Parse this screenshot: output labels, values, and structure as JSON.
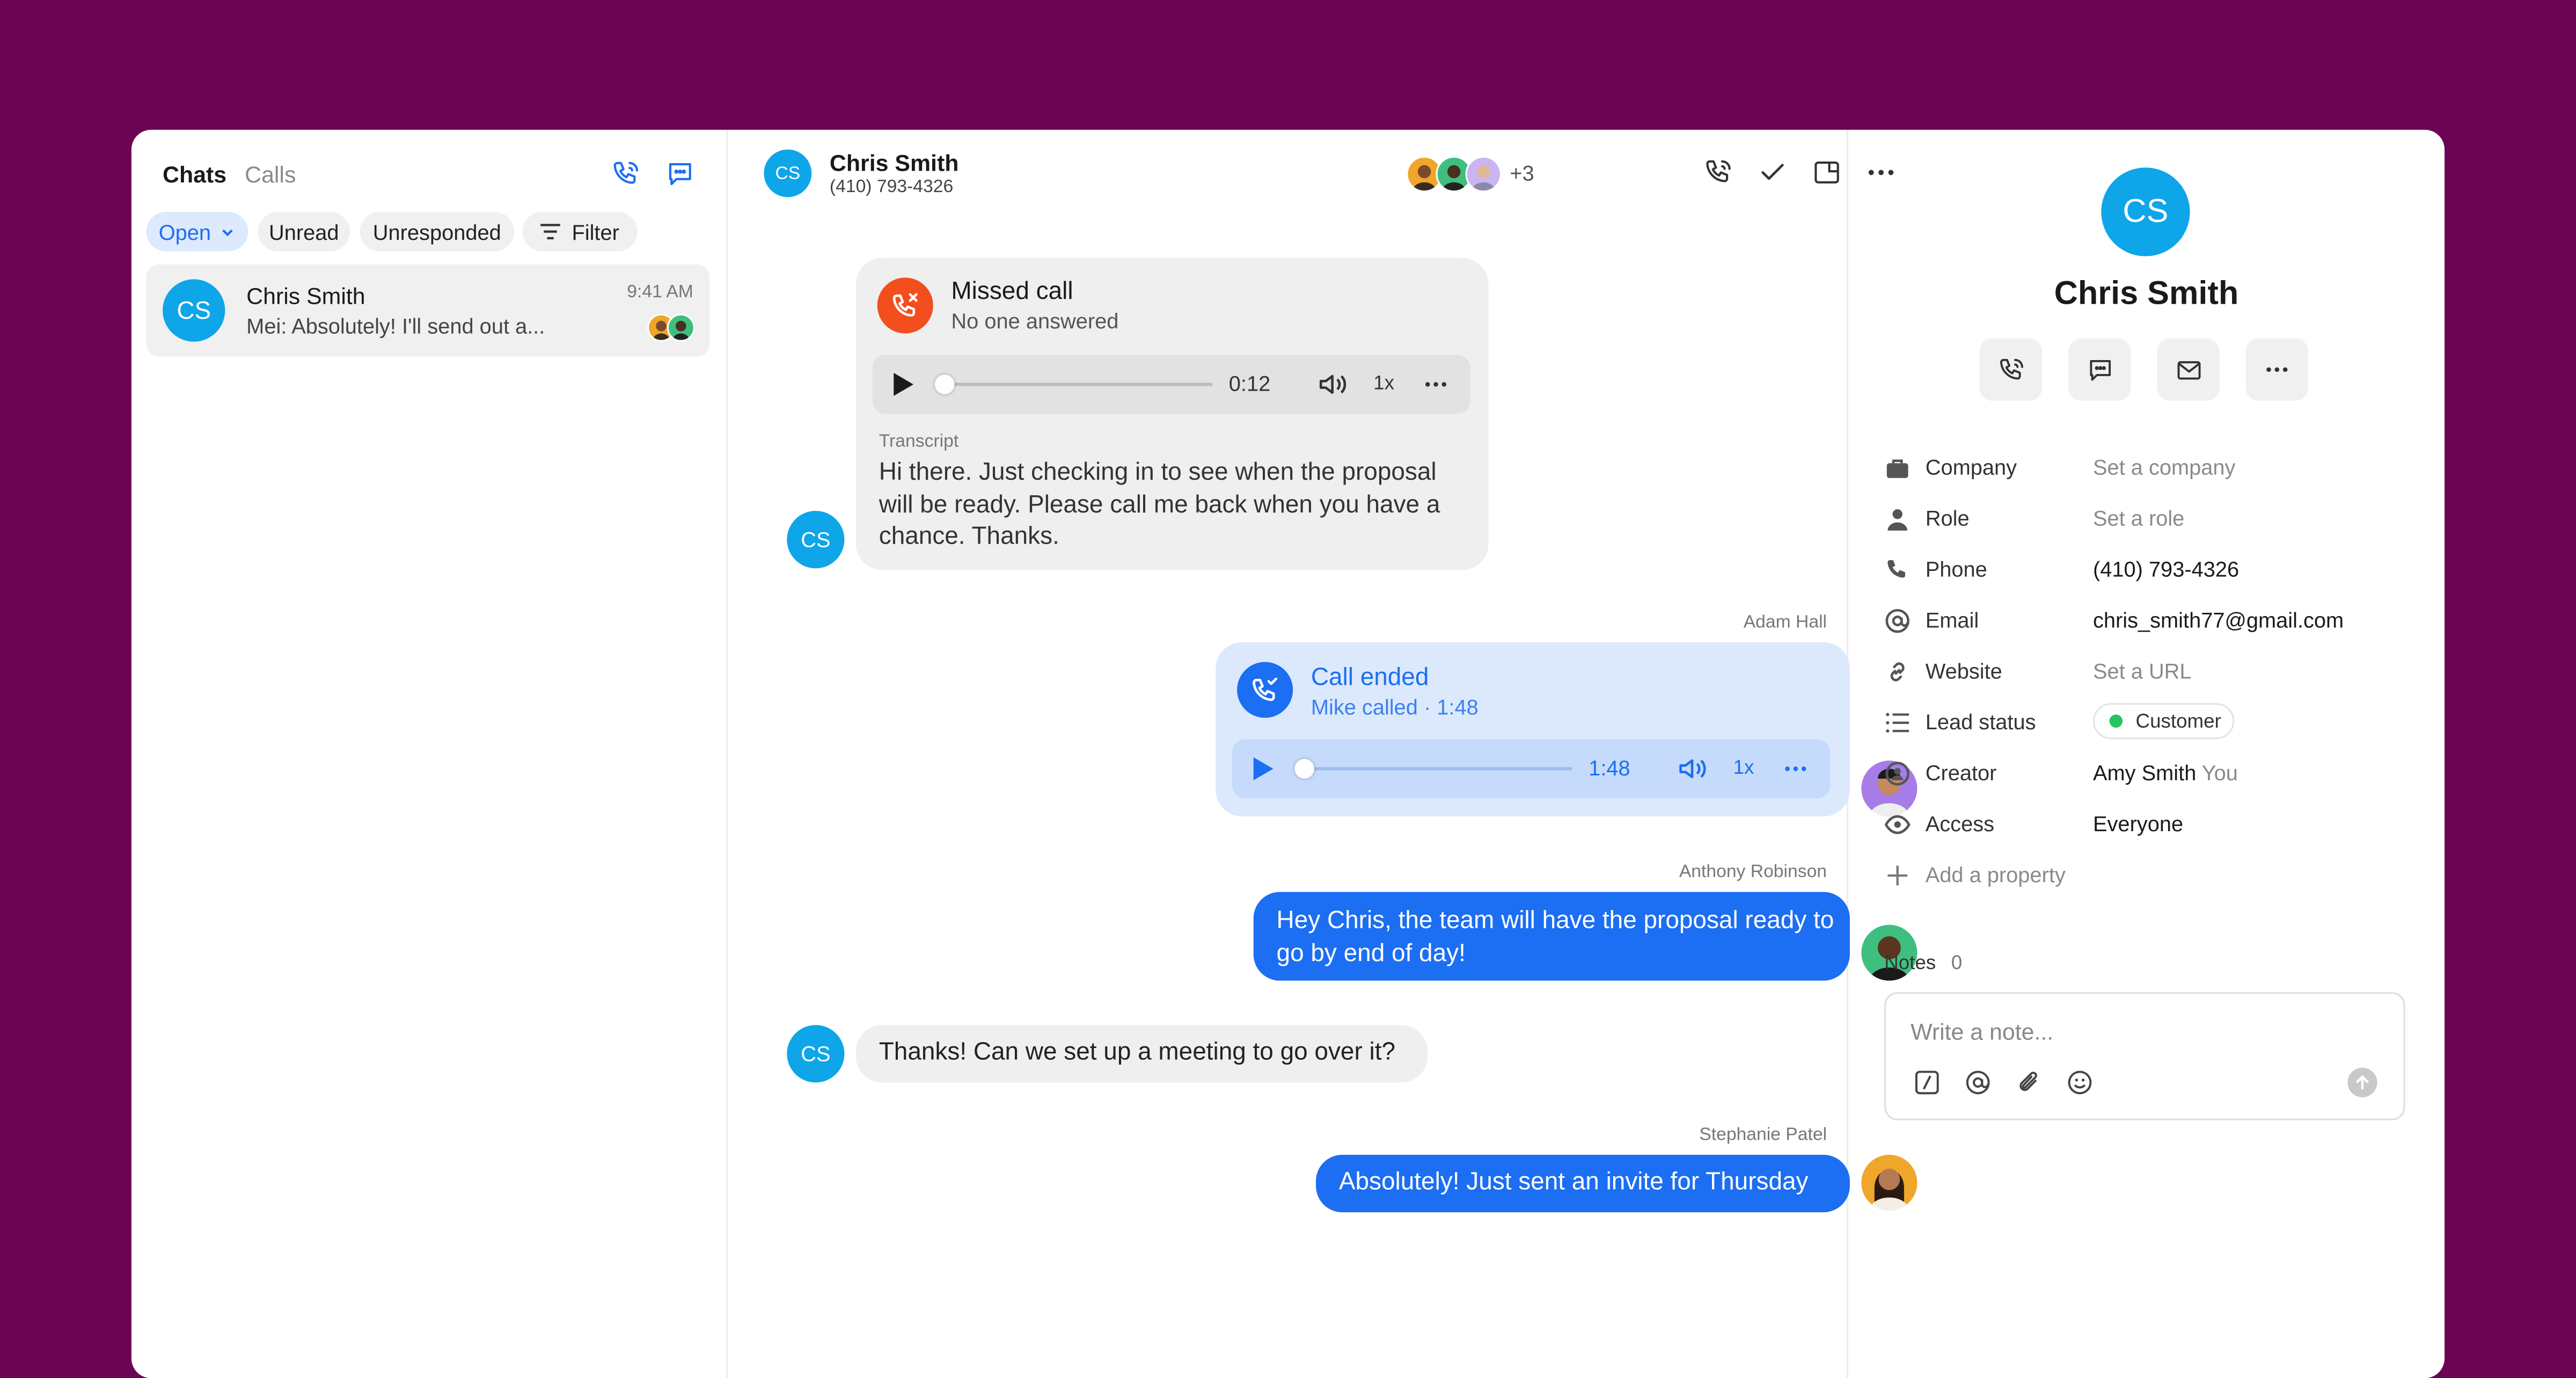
{
  "sidebar": {
    "tabs": [
      "Chats",
      "Calls"
    ],
    "filters": {
      "open": "Open",
      "unread": "Unread",
      "unresponded": "Unresponded",
      "filter": "Filter"
    },
    "conversations": [
      {
        "initials": "CS",
        "name": "Chris Smith",
        "time": "9:41 AM",
        "preview": "Mei: Absolutely! I'll send out a..."
      }
    ]
  },
  "header": {
    "initials": "CS",
    "name": "Chris Smith",
    "phone": "(410) 793-4326",
    "participants_extra": "+3"
  },
  "messages": {
    "missed_call": {
      "title": "Missed call",
      "subtitle": "No one answered",
      "duration": "0:12",
      "speed": "1x",
      "transcript_label": "Transcript",
      "transcript": "Hi there. Just checking in to see when the proposal will be ready. Please call me back when you have a chance. Thanks."
    },
    "call_ended": {
      "sender": "Adam Hall",
      "title": "Call ended",
      "subtitle": "Mike called · 1:48",
      "duration": "1:48",
      "speed": "1x"
    },
    "msg1": {
      "sender": "Anthony Robinson",
      "text": "Hey Chris, the team will have the proposal ready to go by end of day!"
    },
    "msg2": {
      "initials": "CS",
      "text": "Thanks! Can we set up a meeting to go over it?"
    },
    "msg3": {
      "sender": "Stephanie Patel",
      "text": "Absolutely! Just sent an invite for Thursday"
    }
  },
  "contact": {
    "initials": "CS",
    "name": "Chris Smith",
    "properties": [
      {
        "label": "Company",
        "value": "Set a company",
        "icon": "briefcase-icon"
      },
      {
        "label": "Role",
        "value": "Set a role",
        "icon": "person-icon"
      },
      {
        "label": "Phone",
        "value": "(410) 793-4326",
        "icon": "phone-icon"
      },
      {
        "label": "Email",
        "value": "chris_smith77@gmail.com",
        "icon": "at-icon"
      },
      {
        "label": "Website",
        "value": "Set a URL",
        "icon": "link-icon"
      },
      {
        "label": "Lead status",
        "value": "Customer",
        "icon": "list-icon"
      },
      {
        "label": "Creator",
        "value": "Amy Smith",
        "value_suffix": "You",
        "icon": "creator-icon"
      },
      {
        "label": "Access",
        "value": "Everyone",
        "icon": "eye-icon"
      }
    ],
    "add_property": "Add a property",
    "notes_label": "Notes",
    "notes_count": "0",
    "note_placeholder": "Write a note..."
  },
  "colors": {
    "background": "#6b0452",
    "accent": "#1c6ef2",
    "avatar": "#0ea5e9",
    "missed": "#f24e1e",
    "status_green": "#22c55e"
  }
}
